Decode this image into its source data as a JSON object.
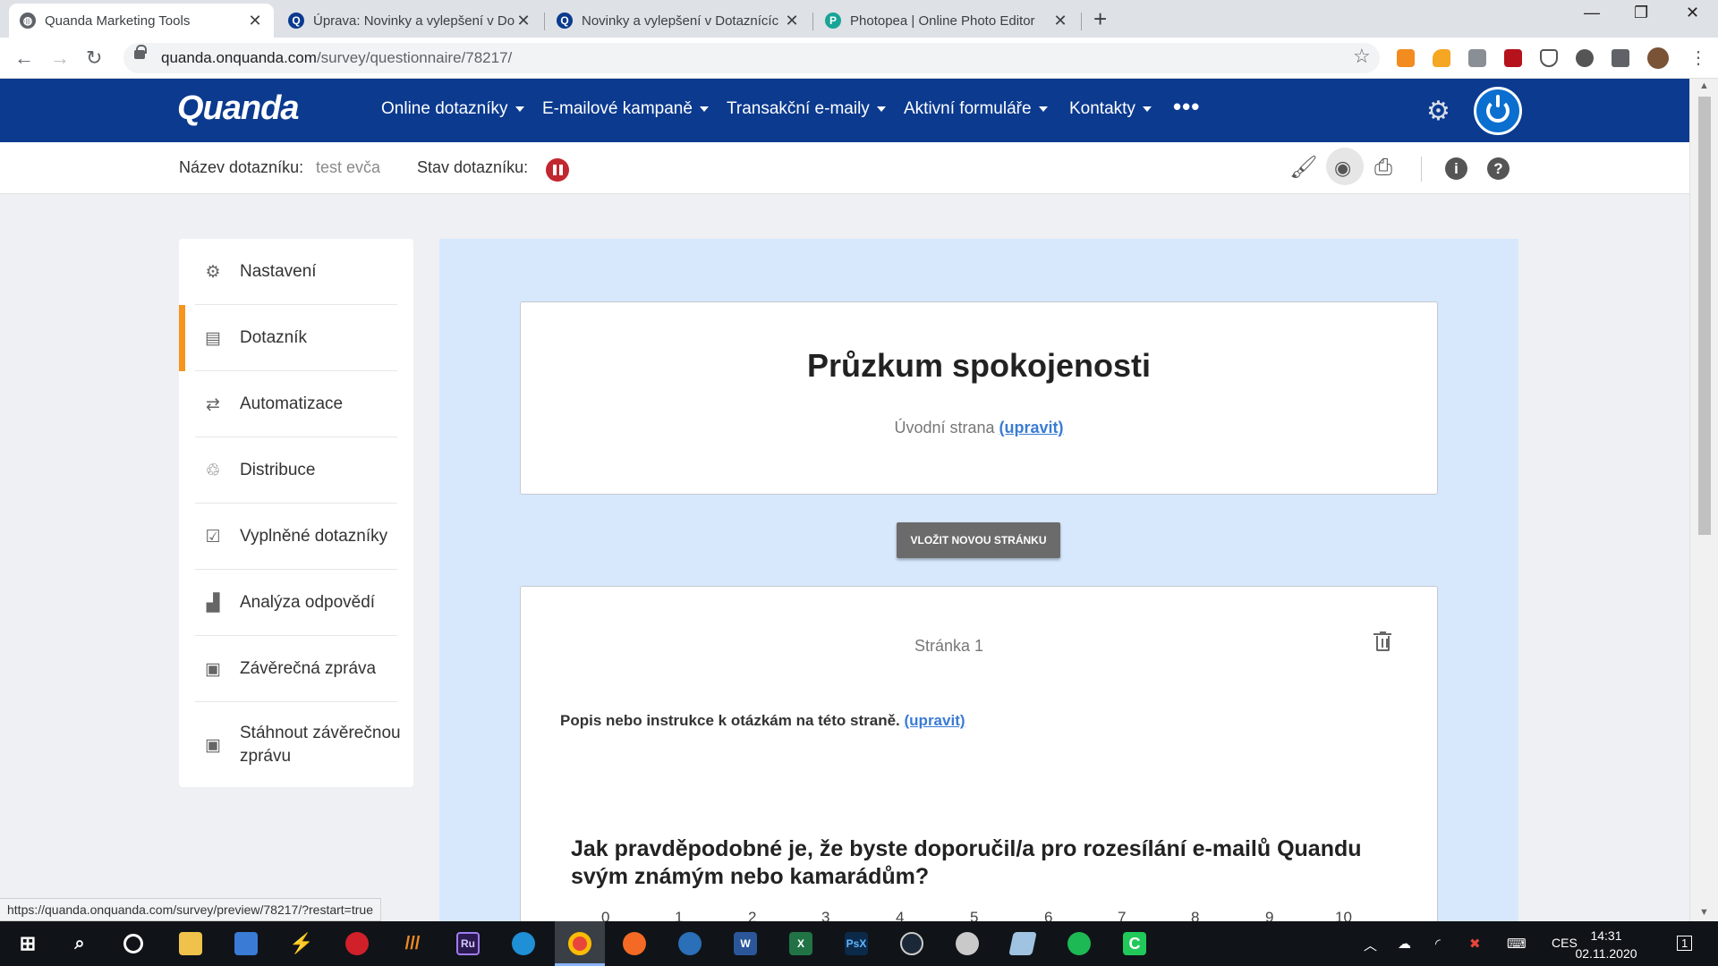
{
  "browser": {
    "tabs": [
      {
        "title": "Quanda Marketing Tools",
        "active": true
      },
      {
        "title": "Úprava: Novinky a vylepšení v Do",
        "active": false
      },
      {
        "title": "Novinky a vylepšení v Dotaznícíc",
        "active": false
      },
      {
        "title": "Photopea | Online Photo Editor",
        "active": false
      }
    ],
    "url_host": "quanda.onquanda.com",
    "url_path": "/survey/questionnaire/78217/",
    "status_url": "https://quanda.onquanda.com/survey/preview/78217/?restart=true"
  },
  "app": {
    "logo": "Quanda",
    "menu": [
      "Online dotazníky",
      "E-mailové kampaně",
      "Transakční e-maily",
      "Aktivní formuláře",
      "Kontakty"
    ],
    "more": "•••"
  },
  "subheader": {
    "name_label": "Název dotazníku:",
    "name_value": "test evča",
    "state_label": "Stav dotazníku:"
  },
  "sidebar": {
    "items": [
      {
        "label": "Nastavení",
        "icon": "gear-icon"
      },
      {
        "label": "Dotazník",
        "icon": "document-icon"
      },
      {
        "label": "Automatizace",
        "icon": "repeat-icon"
      },
      {
        "label": "Distribuce",
        "icon": "recycle-icon"
      },
      {
        "label": "Vyplněné dotazníky",
        "icon": "clipboard-check-icon"
      },
      {
        "label": "Analýza odpovědí",
        "icon": "bar-chart-icon"
      },
      {
        "label": "Závěrečná zpráva",
        "icon": "report-icon"
      },
      {
        "label": "Stáhnout závěrečnou zprávu",
        "icon": "download-report-icon"
      }
    ],
    "active_index": 1,
    "accent": "#f7941d"
  },
  "survey": {
    "title": "Průzkum spokojenosti",
    "intro_label": "Úvodní strana",
    "edit_link": "(upravit)",
    "insert_button": "VLOŽIT NOVOU STRÁNKU",
    "page_label": "Stránka 1",
    "page_description": "Popis nebo instrukce k otázkám na této straně.",
    "question": "Jak pravděpodobné je, že byste doporučil/a pro rozesílání e-mailů Quandu svým známým nebo kamarádům?",
    "scale": [
      "0",
      "1",
      "2",
      "3",
      "4",
      "5",
      "6",
      "7",
      "8",
      "9",
      "10"
    ]
  },
  "taskbar": {
    "language": "CES",
    "time": "14:31",
    "date": "02.11.2020",
    "notification_count": "1"
  },
  "colors": {
    "header_blue": "#0b3a8f",
    "main_bg": "#d7e8fd",
    "status_red": "#c2262e",
    "link": "#3a7bd5"
  }
}
